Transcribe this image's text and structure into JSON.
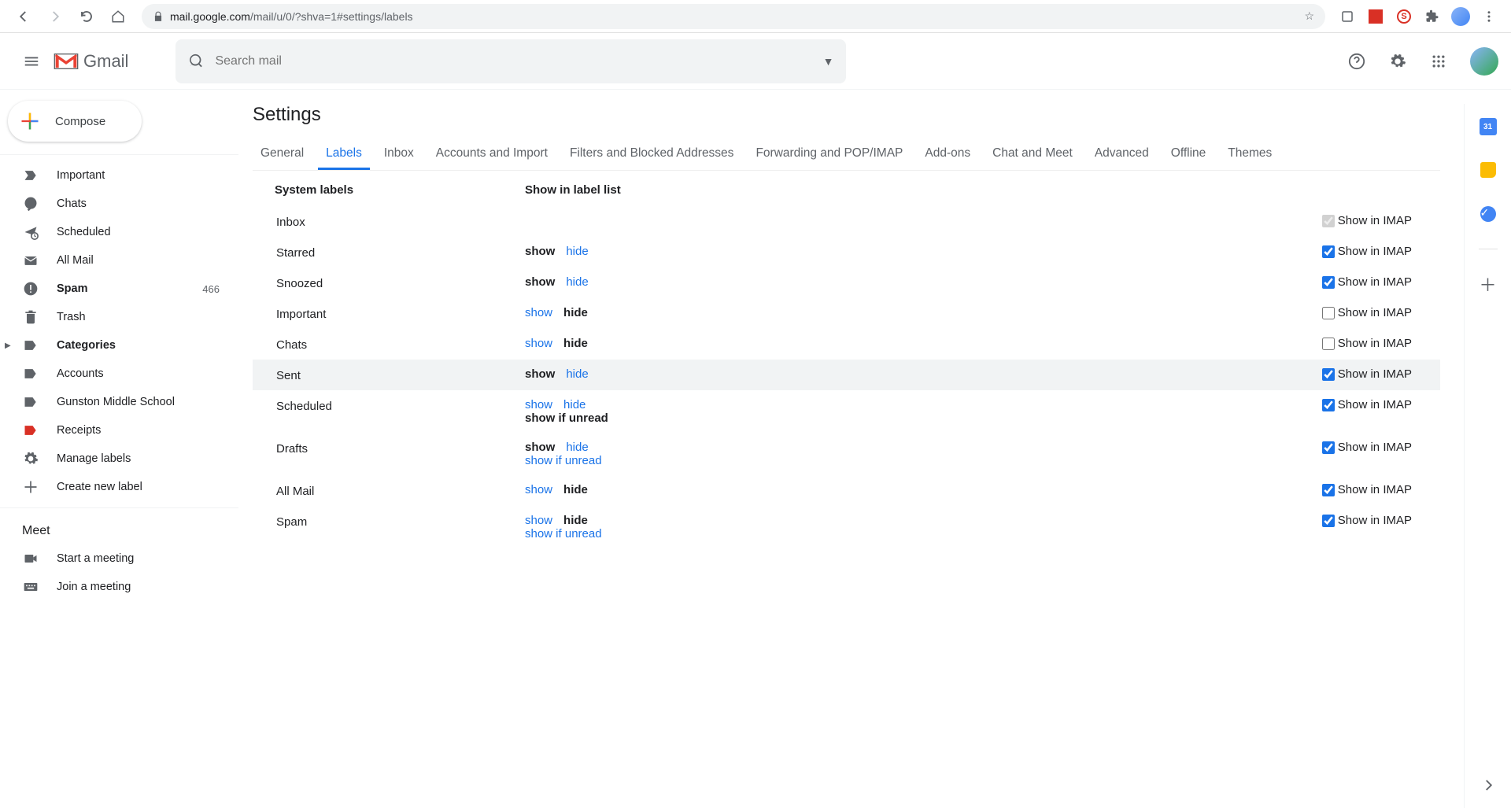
{
  "chrome": {
    "url_host": "mail.google.com",
    "url_path": "/mail/u/0/?shva=1#settings/labels"
  },
  "header": {
    "product_name": "Gmail",
    "search_placeholder": "Search mail"
  },
  "compose": {
    "label": "Compose"
  },
  "sidebar": {
    "items": [
      {
        "label": "Important",
        "icon": "important"
      },
      {
        "label": "Chats",
        "icon": "chats"
      },
      {
        "label": "Scheduled",
        "icon": "scheduled"
      },
      {
        "label": "All Mail",
        "icon": "allmail"
      },
      {
        "label": "Spam",
        "icon": "spam",
        "bold": true,
        "count": "466"
      },
      {
        "label": "Trash",
        "icon": "trash"
      },
      {
        "label": "Categories",
        "icon": "label",
        "bold": true,
        "expandable": true
      },
      {
        "label": "Accounts",
        "icon": "label"
      },
      {
        "label": "Gunston Middle School",
        "icon": "label"
      },
      {
        "label": "Receipts",
        "icon": "label",
        "red": true
      },
      {
        "label": "Manage labels",
        "icon": "gear"
      },
      {
        "label": "Create new label",
        "icon": "plus"
      }
    ],
    "meet_header": "Meet",
    "meet_items": [
      {
        "label": "Start a meeting",
        "icon": "video"
      },
      {
        "label": "Join a meeting",
        "icon": "keyboard"
      }
    ]
  },
  "settings": {
    "title": "Settings",
    "tabs": [
      "General",
      "Labels",
      "Inbox",
      "Accounts and Import",
      "Filters and Blocked Addresses",
      "Forwarding and POP/IMAP",
      "Add-ons",
      "Chat and Meet",
      "Advanced",
      "Offline",
      "Themes"
    ],
    "active_tab": "Labels",
    "col_system": "System labels",
    "col_show": "Show in label list",
    "imap_label": "Show in IMAP",
    "rows": [
      {
        "name": "Inbox",
        "options": [],
        "imap_checked": true,
        "imap_disabled": true
      },
      {
        "name": "Starred",
        "options": [
          "show",
          "hide"
        ],
        "selected": "show",
        "imap_checked": true
      },
      {
        "name": "Snoozed",
        "options": [
          "show",
          "hide"
        ],
        "selected": "show",
        "imap_checked": true
      },
      {
        "name": "Important",
        "options": [
          "show",
          "hide"
        ],
        "selected": "hide",
        "imap_checked": false
      },
      {
        "name": "Chats",
        "options": [
          "show",
          "hide"
        ],
        "selected": "hide",
        "imap_checked": false
      },
      {
        "name": "Sent",
        "options": [
          "show",
          "hide"
        ],
        "selected": "show",
        "imap_checked": true,
        "hover": true
      },
      {
        "name": "Scheduled",
        "options": [
          "show",
          "hide",
          "show if unread"
        ],
        "selected": "show if unread",
        "imap_checked": true
      },
      {
        "name": "Drafts",
        "options": [
          "show",
          "hide",
          "show if unread"
        ],
        "selected": "show",
        "imap_checked": true
      },
      {
        "name": "All Mail",
        "options": [
          "show",
          "hide"
        ],
        "selected": "hide",
        "imap_checked": true
      },
      {
        "name": "Spam",
        "options": [
          "show",
          "hide",
          "show if unread"
        ],
        "selected": "hide",
        "imap_checked": true
      }
    ]
  },
  "side_panel": {
    "calendar_day": "31"
  }
}
